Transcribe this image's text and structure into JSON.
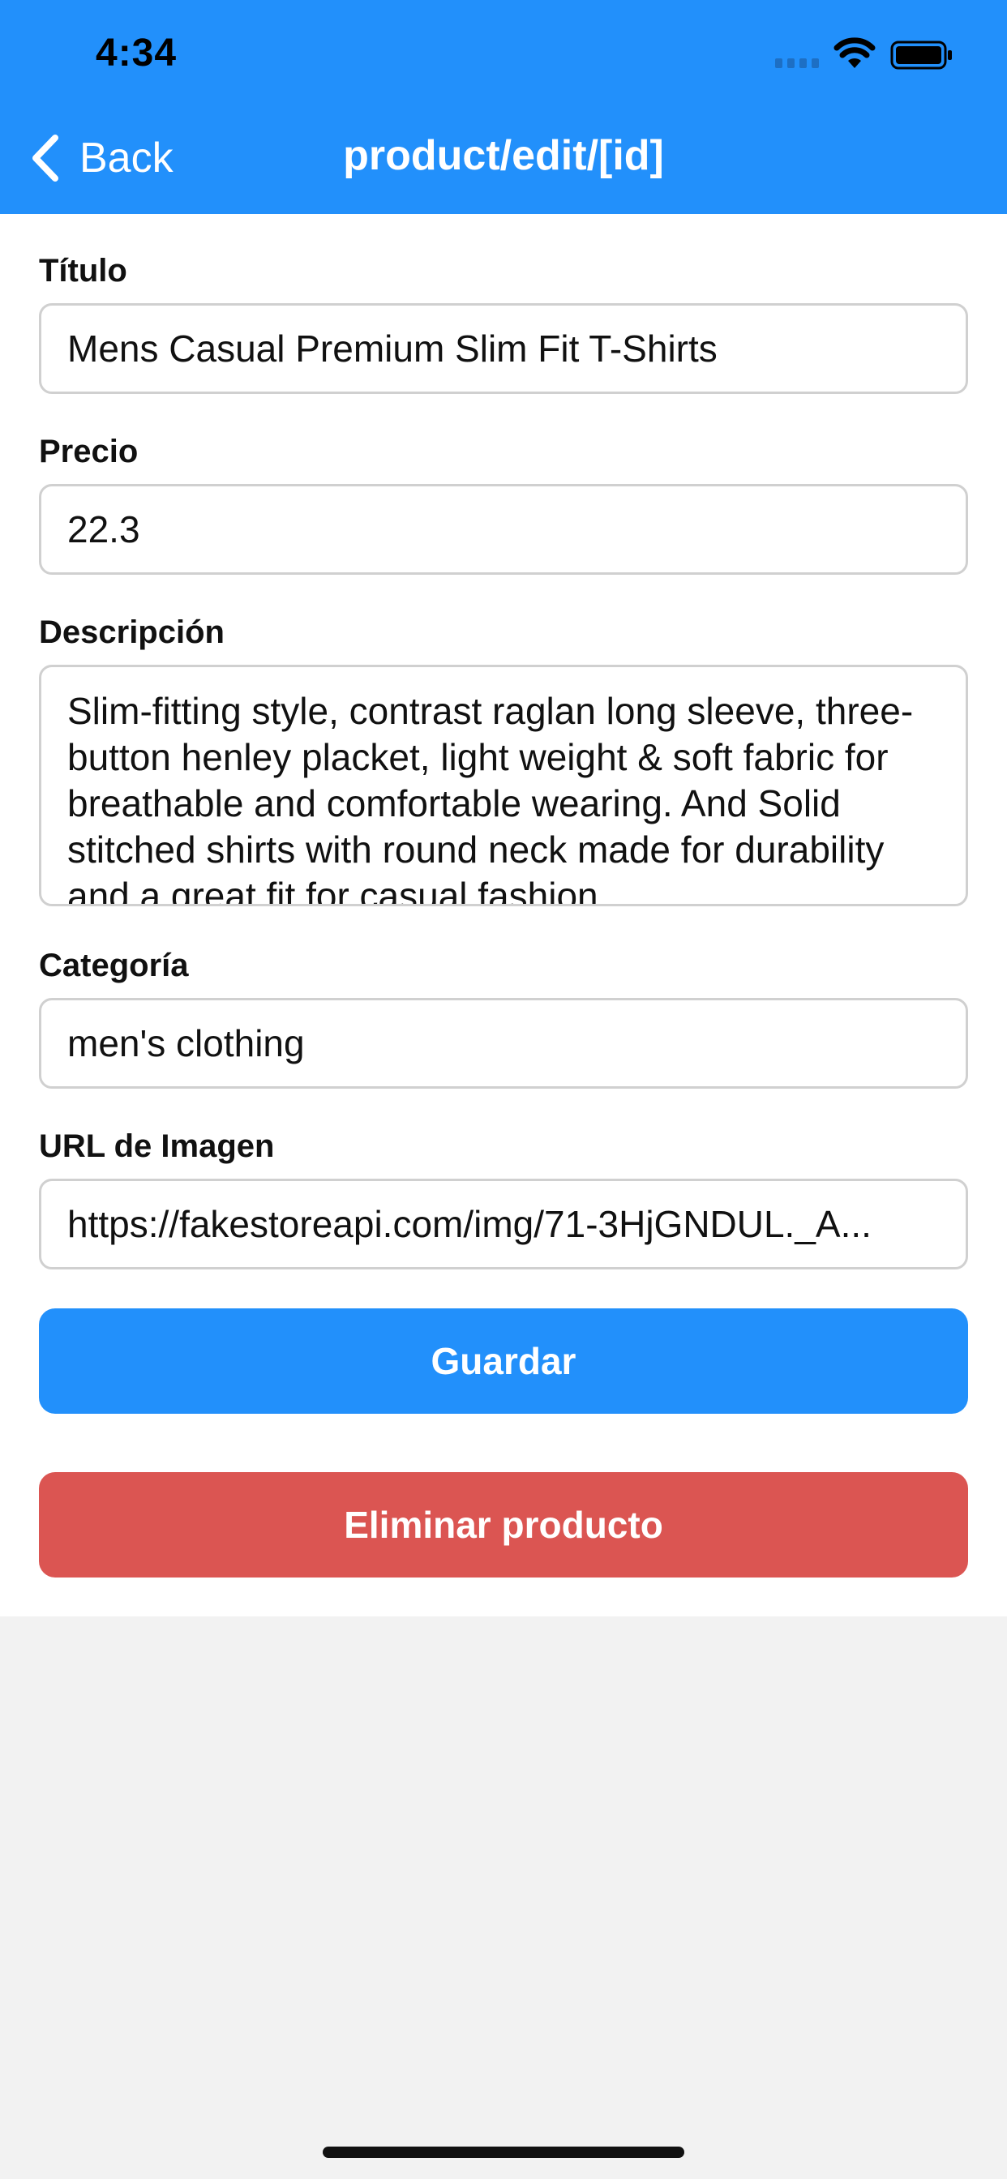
{
  "status_bar": {
    "time": "4:34"
  },
  "nav": {
    "back_label": "Back",
    "title": "product/edit/[id]"
  },
  "form": {
    "title_label": "Título",
    "title_value": "Mens Casual Premium Slim Fit T-Shirts",
    "price_label": "Precio",
    "price_value": "22.3",
    "description_label": "Descripción",
    "description_value": "Slim-fitting style, contrast raglan long sleeve, three-button henley placket, light weight & soft fabric for breathable and comfortable wearing. And Solid stitched shirts with round neck made for durability and a great fit for casual fashion",
    "category_label": "Categoría",
    "category_value": "men's clothing",
    "image_label": "URL de Imagen",
    "image_value": "https://fakestoreapi.com/img/71-3HjGNDUL._A..."
  },
  "actions": {
    "save_label": "Guardar",
    "delete_label": "Eliminar producto"
  },
  "colors": {
    "primary": "#2290fb",
    "danger": "#db5552",
    "background": "#f2f2f2"
  }
}
